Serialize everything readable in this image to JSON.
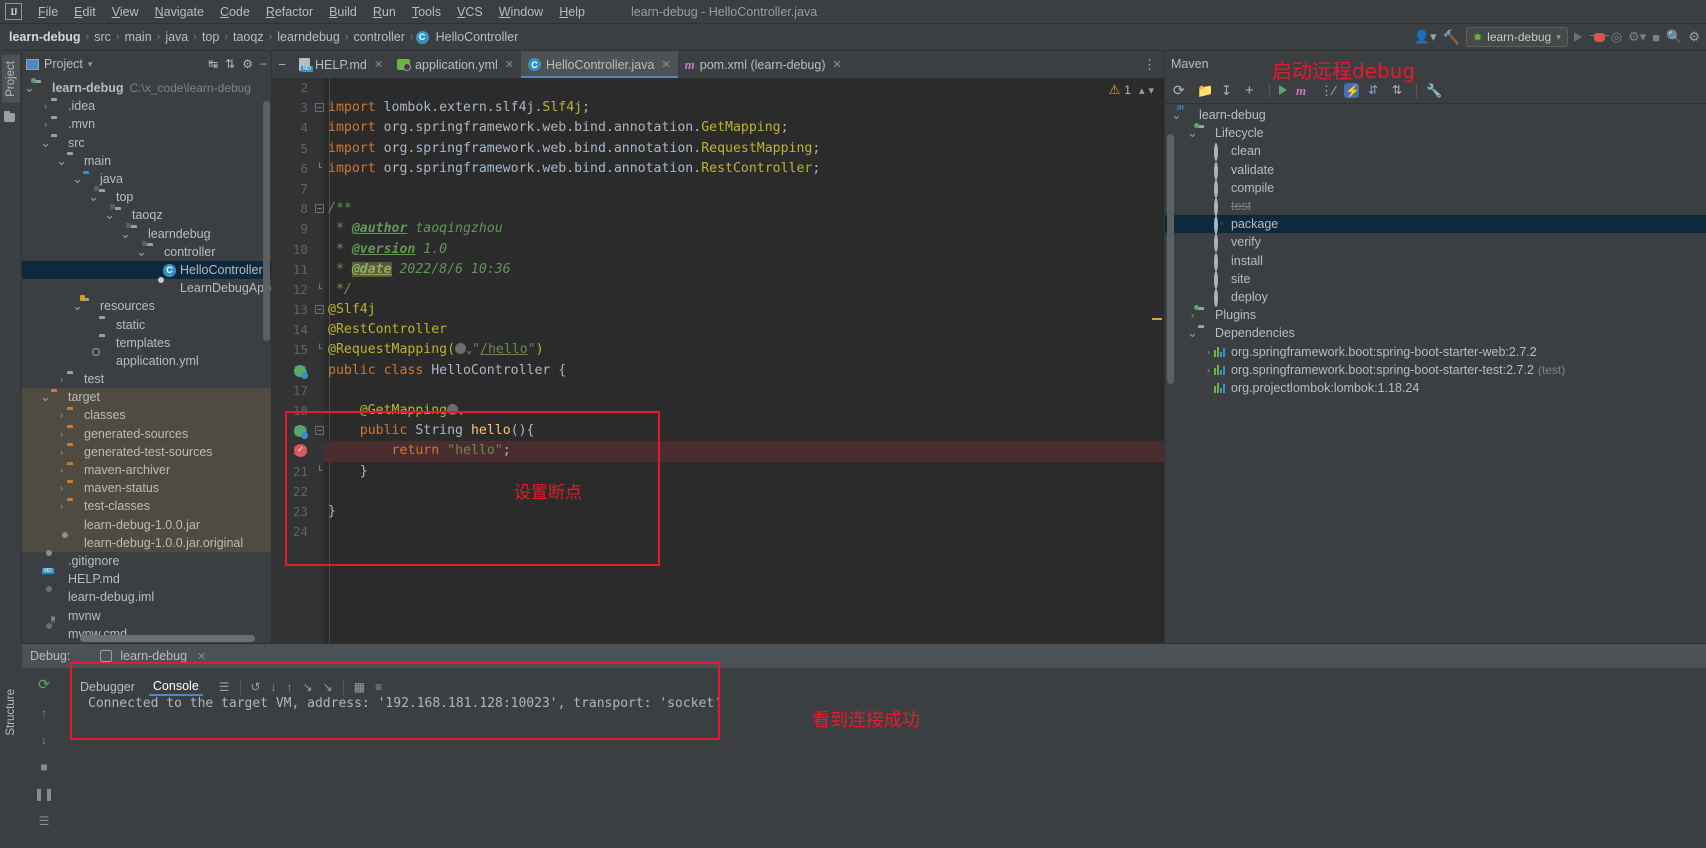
{
  "window": {
    "title": "learn-debug - HelloController.java"
  },
  "menubar": {
    "items": [
      "File",
      "Edit",
      "View",
      "Navigate",
      "Code",
      "Refactor",
      "Build",
      "Run",
      "Tools",
      "VCS",
      "Window",
      "Help"
    ]
  },
  "navbar": {
    "crumbs": [
      "learn-debug",
      "src",
      "main",
      "java",
      "top",
      "taoqz",
      "learndebug",
      "controller"
    ],
    "class_crumb": "HelloController",
    "class_icon_letter": "C",
    "run_config": "learn-debug",
    "run_icon": "play-icon",
    "debug_icon": "bug-icon"
  },
  "left_strip": {
    "project_tab": "Project",
    "structure_tab": "Structure"
  },
  "project_panel": {
    "title": "Project",
    "tree": [
      {
        "label": "learn-debug",
        "path": "C:\\x_code\\learn-debug",
        "depth": 0,
        "arrow": "down",
        "icon": "module-folder",
        "bold": true
      },
      {
        "label": ".idea",
        "depth": 1,
        "arrow": "right",
        "icon": "folder"
      },
      {
        "label": ".mvn",
        "depth": 1,
        "arrow": "right",
        "icon": "folder"
      },
      {
        "label": "src",
        "depth": 1,
        "arrow": "down",
        "icon": "folder"
      },
      {
        "label": "main",
        "depth": 2,
        "arrow": "down",
        "icon": "folder"
      },
      {
        "label": "java",
        "depth": 3,
        "arrow": "down",
        "icon": "folder-blue"
      },
      {
        "label": "top",
        "depth": 4,
        "arrow": "down",
        "icon": "package"
      },
      {
        "label": "taoqz",
        "depth": 5,
        "arrow": "down",
        "icon": "package"
      },
      {
        "label": "learndebug",
        "depth": 6,
        "arrow": "down",
        "icon": "package"
      },
      {
        "label": "controller",
        "depth": 7,
        "arrow": "down",
        "icon": "package"
      },
      {
        "label": "HelloController",
        "depth": 8,
        "arrow": "none",
        "icon": "class",
        "selected": true
      },
      {
        "label": "LearnDebugApplication",
        "depth": 8,
        "arrow": "none",
        "icon": "spring-class"
      },
      {
        "label": "resources",
        "depth": 3,
        "arrow": "down",
        "icon": "folder-resources"
      },
      {
        "label": "static",
        "depth": 4,
        "arrow": "none",
        "icon": "folder"
      },
      {
        "label": "templates",
        "depth": 4,
        "arrow": "none",
        "icon": "folder"
      },
      {
        "label": "application.yml",
        "depth": 4,
        "arrow": "none",
        "icon": "yml"
      },
      {
        "label": "test",
        "depth": 2,
        "arrow": "right",
        "icon": "folder"
      },
      {
        "label": "target",
        "depth": 1,
        "arrow": "down",
        "icon": "folder-orange",
        "excluded": true
      },
      {
        "label": "classes",
        "depth": 2,
        "arrow": "right",
        "icon": "folder-orange",
        "excluded": true
      },
      {
        "label": "generated-sources",
        "depth": 2,
        "arrow": "right",
        "icon": "folder-orange",
        "excluded": true
      },
      {
        "label": "generated-test-sources",
        "depth": 2,
        "arrow": "right",
        "icon": "folder-orange",
        "excluded": true
      },
      {
        "label": "maven-archiver",
        "depth": 2,
        "arrow": "right",
        "icon": "folder-orange",
        "excluded": true
      },
      {
        "label": "maven-status",
        "depth": 2,
        "arrow": "right",
        "icon": "folder-orange",
        "excluded": true
      },
      {
        "label": "test-classes",
        "depth": 2,
        "arrow": "right",
        "icon": "folder-orange",
        "excluded": true
      },
      {
        "label": "learn-debug-1.0.0.jar",
        "depth": 2,
        "arrow": "none",
        "icon": "jar",
        "excluded": true
      },
      {
        "label": "learn-debug-1.0.0.jar.original",
        "depth": 2,
        "arrow": "none",
        "icon": "file-unknown",
        "excluded": true
      },
      {
        "label": ".gitignore",
        "depth": 1,
        "arrow": "none",
        "icon": "file-ignore"
      },
      {
        "label": "HELP.md",
        "depth": 1,
        "arrow": "none",
        "icon": "markdown"
      },
      {
        "label": "learn-debug.iml",
        "depth": 1,
        "arrow": "none",
        "icon": "file-iml"
      },
      {
        "label": "mvnw",
        "depth": 1,
        "arrow": "none",
        "icon": "shell"
      },
      {
        "label": "mvnw.cmd",
        "depth": 1,
        "arrow": "none",
        "icon": "cmd"
      }
    ]
  },
  "editor": {
    "tabs": [
      {
        "label": "HELP.md",
        "icon": "markdown-icon",
        "active": false
      },
      {
        "label": "application.yml",
        "icon": "yml-icon",
        "active": false
      },
      {
        "label": "HelloController.java",
        "icon": "class-icon",
        "active": true
      },
      {
        "label": "pom.xml (learn-debug)",
        "icon": "maven-icon",
        "active": false
      }
    ],
    "warning_count": "1",
    "first_visible_line": 2,
    "code_lines": [
      {
        "n": 2,
        "html": ""
      },
      {
        "n": 3,
        "html": "<span class=\"kw\">import</span> <span class=\"pln\">lombok.extern.slf4j.</span><span class=\"imp-cls\">Slf4j</span><span class=\"pln\">;</span>",
        "fold": "minus"
      },
      {
        "n": 4,
        "html": "<span class=\"kw\">import</span> <span class=\"pln\">org.springframework.web.bind.annotation.</span><span class=\"imp-cls\">GetMapping</span><span class=\"pln\">;</span>"
      },
      {
        "n": 5,
        "html": "<span class=\"kw\">import</span> <span class=\"pln\">org.springframework.web.bind.annotation.</span><span class=\"imp-cls\">RequestMapping</span><span class=\"pln\">;</span>"
      },
      {
        "n": 6,
        "html": "<span class=\"kw\">import</span> <span class=\"pln\">org.springframework.web.bind.annotation.</span><span class=\"imp-cls\">RestController</span><span class=\"pln\">;</span>",
        "fold": "end"
      },
      {
        "n": 7,
        "html": ""
      },
      {
        "n": 8,
        "html": "<span class=\"cmt\">/**</span>",
        "fold": "minus"
      },
      {
        "n": 9,
        "html": "<span class=\"cmt\"> * </span><span class=\"cmt-tag\">@author</span><span class=\"cmt\"> taoqingzhou</span>"
      },
      {
        "n": 10,
        "html": "<span class=\"cmt\"> * </span><span class=\"cmt-tag\">@version</span><span class=\"cmt\"> 1.0</span>"
      },
      {
        "n": 11,
        "html": "<span class=\"cmt\"> * </span><span class=\"cmt-tag-hl\">@date</span><span class=\"cmt\"> 2022/8/6 10:36</span>"
      },
      {
        "n": 12,
        "html": "<span class=\"cmt\"> */</span>",
        "fold": "end"
      },
      {
        "n": 13,
        "html": "<span class=\"ann\">@Slf4j</span>",
        "fold": "minus"
      },
      {
        "n": 14,
        "html": "<span class=\"ann\">@RestController</span>"
      },
      {
        "n": 15,
        "html": "<span class=\"ann\">@RequestMapping(</span><span class=\"web-badge-slot\"></span><span class=\"str\">\"</span><span class=\"url\">/hello</span><span class=\"str\">\"</span><span class=\"ann\">)</span>",
        "fold": "end"
      },
      {
        "n": 16,
        "html": "<span class=\"kw\">public class</span> <span class=\"cls-name\">HelloController</span> <span class=\"pln\">{</span>",
        "gutter": "run"
      },
      {
        "n": 17,
        "html": ""
      },
      {
        "n": 18,
        "html": "    <span class=\"ann\">@GetMapping</span><span class=\"web-badge-slot\"></span>"
      },
      {
        "n": 19,
        "html": "    <span class=\"kw\">public</span> <span class=\"typ\">String</span> <span class=\"mth\">hello</span><span class=\"pln\">(){</span>",
        "gutter": "run",
        "fold": "minus"
      },
      {
        "n": 20,
        "html": "        <span class=\"kw\">return</span> <span class=\"str\">\"hello\"</span><span class=\"pln\">;</span>",
        "gutter": "breakpoint",
        "highlight": true
      },
      {
        "n": 21,
        "html": "    <span class=\"pln\">}</span>",
        "fold": "end"
      },
      {
        "n": 22,
        "html": ""
      },
      {
        "n": 23,
        "html": "<span class=\"pln\">}</span>"
      },
      {
        "n": 24,
        "html": ""
      }
    ]
  },
  "annotations": [
    {
      "id": "breakpoint-note",
      "text": "设置断点"
    },
    {
      "id": "remote-debug-note",
      "text": "启动远程debug"
    },
    {
      "id": "connection-note",
      "text": "看到连接成功"
    }
  ],
  "maven_panel": {
    "title": "Maven",
    "toolbar_icons": [
      "reload-icon",
      "add-maven-project-icon",
      "download-sources-icon",
      "plus-icon",
      "run-icon",
      "execute-maven-goal-icon",
      "toggle-offline-icon",
      "skip-tests-icon",
      "expand-all-icon",
      "collapse-all-icon",
      "settings-icon"
    ],
    "tree": [
      {
        "label": "learn-debug",
        "depth": 0,
        "arrow": "down",
        "icon": "maven-project"
      },
      {
        "label": "Lifecycle",
        "depth": 1,
        "arrow": "down",
        "icon": "lifecycle-folder"
      },
      {
        "label": "clean",
        "depth": 2,
        "arrow": "none",
        "icon": "goal"
      },
      {
        "label": "validate",
        "depth": 2,
        "arrow": "none",
        "icon": "goal"
      },
      {
        "label": "compile",
        "depth": 2,
        "arrow": "none",
        "icon": "goal"
      },
      {
        "label": "test",
        "depth": 2,
        "arrow": "none",
        "icon": "goal",
        "struck": true
      },
      {
        "label": "package",
        "depth": 2,
        "arrow": "none",
        "icon": "goal",
        "selected": true
      },
      {
        "label": "verify",
        "depth": 2,
        "arrow": "none",
        "icon": "goal"
      },
      {
        "label": "install",
        "depth": 2,
        "arrow": "none",
        "icon": "goal"
      },
      {
        "label": "site",
        "depth": 2,
        "arrow": "none",
        "icon": "goal"
      },
      {
        "label": "deploy",
        "depth": 2,
        "arrow": "none",
        "icon": "goal"
      },
      {
        "label": "Plugins",
        "depth": 1,
        "arrow": "right",
        "icon": "plugins-folder"
      },
      {
        "label": "Dependencies",
        "depth": 1,
        "arrow": "down",
        "icon": "dependencies-folder"
      },
      {
        "label": "org.springframework.boot:spring-boot-starter-web:2.7.2",
        "depth": 2,
        "arrow": "right",
        "icon": "dependency"
      },
      {
        "label": "org.springframework.boot:spring-boot-starter-test:2.7.2",
        "suffix": "(test)",
        "depth": 2,
        "arrow": "right",
        "icon": "dependency"
      },
      {
        "label": "org.projectlombok:lombok:1.18.24",
        "depth": 2,
        "arrow": "none",
        "icon": "dependency"
      }
    ]
  },
  "debug_panel": {
    "label": "Debug:",
    "session_tab": "learn-debug",
    "tabs": [
      {
        "label": "Debugger",
        "selected": false
      },
      {
        "label": "Console",
        "selected": true
      }
    ],
    "console_output": "Connected to the target VM, address: '192.168.181.128:10023', transport: 'socket'"
  },
  "colors": {
    "accent_blue": "#4a88c7",
    "selection_blue": "#0d293e",
    "annotation_red": "#e8192c",
    "editor_bg": "#2b2b2b",
    "panel_bg": "#3c3f41",
    "breakpoint_red": "#db5860",
    "excluded_folder": "#4f4b41",
    "string_green": "#6a8759",
    "keyword_orange": "#cc7832",
    "annotation_yellow": "#bbb529",
    "comment_green": "#629755"
  }
}
